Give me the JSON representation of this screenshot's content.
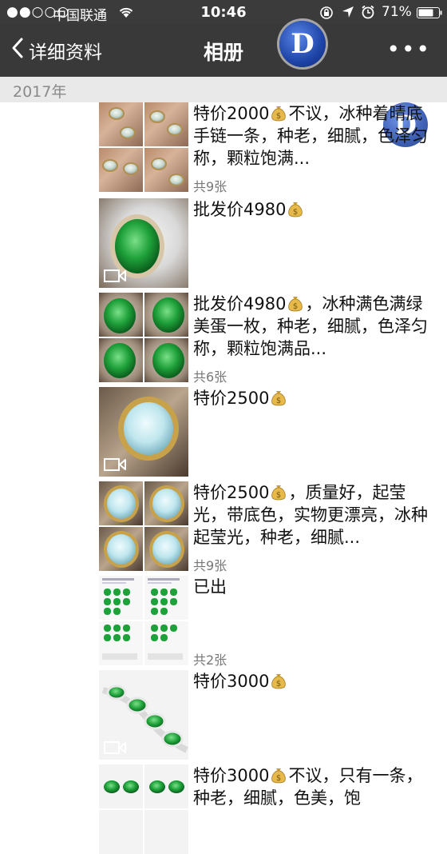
{
  "status_bar": {
    "signal": "●●○○○",
    "carrier": "中国联通",
    "time": "10:46",
    "battery": "71%",
    "icons": [
      "wifi-icon",
      "rotation-lock-icon",
      "location-icon",
      "alarm-icon",
      "battery-icon"
    ]
  },
  "nav": {
    "back_label": "详细资料",
    "title": "相册",
    "more": "•••",
    "logo_letter": "D"
  },
  "year": "2017年",
  "posts": [
    {
      "text": "特价2000",
      "after_bag": "不议，冰种着晴底手链一条，种老，细腻，色泽匀称，颗粒饱满...",
      "count": "共9张",
      "thumb": "bracelet-grid",
      "video": false
    },
    {
      "text": "批发价4980",
      "after_bag": "",
      "count": "",
      "thumb": "green-ring",
      "video": true
    },
    {
      "text": "批发价4980",
      "after_bag": "，冰种满色满绿美蛋一枚，种老，细腻，色泽匀称，颗粒饱满品...",
      "count": "共6张",
      "thumb": "green-grid",
      "video": false
    },
    {
      "text": "特价2500",
      "after_bag": "",
      "count": "",
      "thumb": "blue-ring",
      "video": true
    },
    {
      "text": "特价2500",
      "after_bag": "，质量好，起莹光，带底色，实物更漂亮，冰种起莹光，种老，细腻...",
      "count": "共9张",
      "thumb": "blue-grid",
      "video": false
    },
    {
      "text": "已出",
      "after_bag": null,
      "count": "共2张",
      "thumb": "screenshot-grid",
      "video": false
    },
    {
      "text": "特价3000",
      "after_bag": "",
      "count": "",
      "thumb": "green-bracelet",
      "video": true
    },
    {
      "text": "特价3000",
      "after_bag": "不议，只有一条，种老，细腻，色美，饱",
      "count": "",
      "thumb": "green-bracelet-grid",
      "video": false
    }
  ],
  "colors": {
    "nav_bg": "#393939",
    "status_bg": "#3b3b3b",
    "year_bg": "#e9e9e9",
    "jade_green": "#1fa13a",
    "ice_blue": "#bfe6ee",
    "gold": "#c8a24a"
  }
}
